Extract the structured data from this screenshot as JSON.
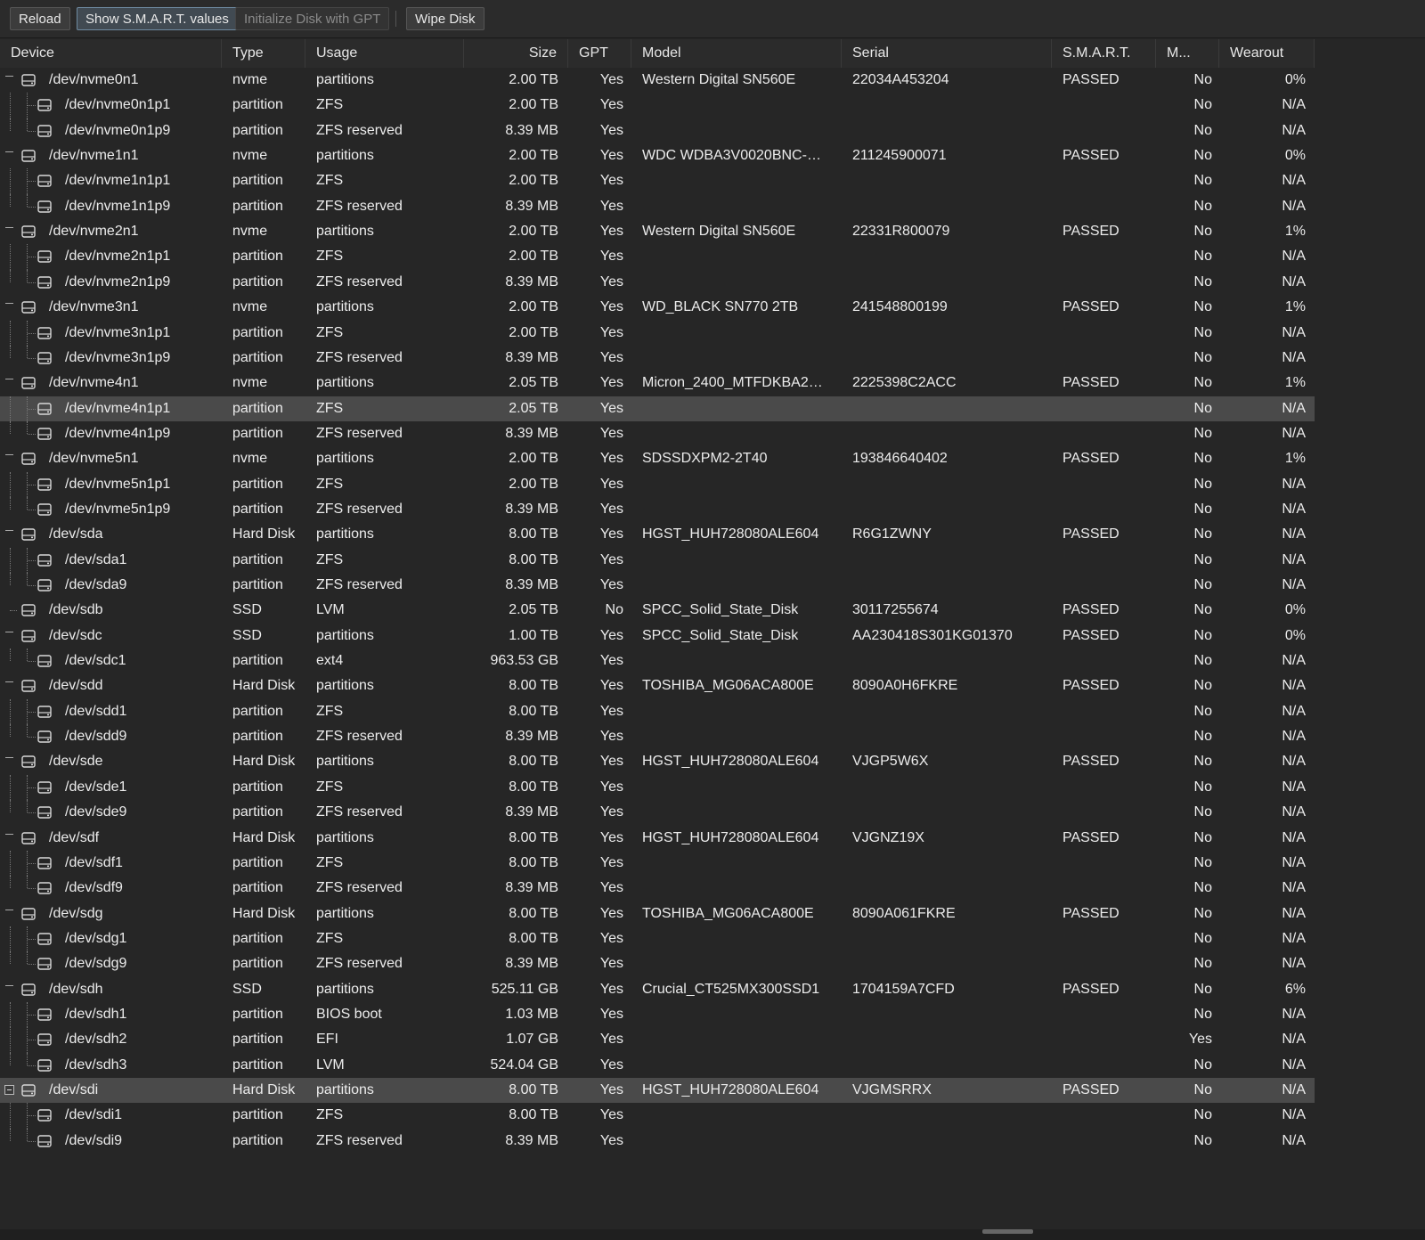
{
  "toolbar": {
    "reload": "Reload",
    "smart": "Show S.M.A.R.T. values",
    "init_gpt": "Initialize Disk with GPT",
    "wipe": "Wipe Disk"
  },
  "columns": {
    "device": "Device",
    "type": "Type",
    "usage": "Usage",
    "size": "Size",
    "gpt": "GPT",
    "model": "Model",
    "serial": "Serial",
    "smart": "S.M.A.R.T.",
    "mounted": "M...",
    "wearout": "Wearout"
  },
  "rows": [
    {
      "level": 0,
      "device": "/dev/nvme0n1",
      "type": "nvme",
      "usage": "partitions",
      "size": "2.00 TB",
      "gpt": "Yes",
      "model": "Western Digital SN560E",
      "serial": "22034A453204",
      "smart": "PASSED",
      "mounted": "No",
      "wearout": "0%"
    },
    {
      "level": 1,
      "device": "/dev/nvme0n1p1",
      "type": "partition",
      "usage": "ZFS",
      "size": "2.00 TB",
      "gpt": "Yes",
      "model": "",
      "serial": "",
      "smart": "",
      "mounted": "No",
      "wearout": "N/A"
    },
    {
      "level": 1,
      "last": true,
      "device": "/dev/nvme0n1p9",
      "type": "partition",
      "usage": "ZFS reserved",
      "size": "8.39 MB",
      "gpt": "Yes",
      "model": "",
      "serial": "",
      "smart": "",
      "mounted": "No",
      "wearout": "N/A"
    },
    {
      "level": 0,
      "device": "/dev/nvme1n1",
      "type": "nvme",
      "usage": "partitions",
      "size": "2.00 TB",
      "gpt": "Yes",
      "model": "WDC WDBA3V0020BNC-W...",
      "serial": "211245900071",
      "smart": "PASSED",
      "mounted": "No",
      "wearout": "0%"
    },
    {
      "level": 1,
      "device": "/dev/nvme1n1p1",
      "type": "partition",
      "usage": "ZFS",
      "size": "2.00 TB",
      "gpt": "Yes",
      "model": "",
      "serial": "",
      "smart": "",
      "mounted": "No",
      "wearout": "N/A"
    },
    {
      "level": 1,
      "last": true,
      "device": "/dev/nvme1n1p9",
      "type": "partition",
      "usage": "ZFS reserved",
      "size": "8.39 MB",
      "gpt": "Yes",
      "model": "",
      "serial": "",
      "smart": "",
      "mounted": "No",
      "wearout": "N/A"
    },
    {
      "level": 0,
      "device": "/dev/nvme2n1",
      "type": "nvme",
      "usage": "partitions",
      "size": "2.00 TB",
      "gpt": "Yes",
      "model": "Western Digital SN560E",
      "serial": "22331R800079",
      "smart": "PASSED",
      "mounted": "No",
      "wearout": "1%"
    },
    {
      "level": 1,
      "device": "/dev/nvme2n1p1",
      "type": "partition",
      "usage": "ZFS",
      "size": "2.00 TB",
      "gpt": "Yes",
      "model": "",
      "serial": "",
      "smart": "",
      "mounted": "No",
      "wearout": "N/A"
    },
    {
      "level": 1,
      "last": true,
      "device": "/dev/nvme2n1p9",
      "type": "partition",
      "usage": "ZFS reserved",
      "size": "8.39 MB",
      "gpt": "Yes",
      "model": "",
      "serial": "",
      "smart": "",
      "mounted": "No",
      "wearout": "N/A"
    },
    {
      "level": 0,
      "device": "/dev/nvme3n1",
      "type": "nvme",
      "usage": "partitions",
      "size": "2.00 TB",
      "gpt": "Yes",
      "model": "WD_BLACK SN770 2TB",
      "serial": "241548800199",
      "smart": "PASSED",
      "mounted": "No",
      "wearout": "1%"
    },
    {
      "level": 1,
      "device": "/dev/nvme3n1p1",
      "type": "partition",
      "usage": "ZFS",
      "size": "2.00 TB",
      "gpt": "Yes",
      "model": "",
      "serial": "",
      "smart": "",
      "mounted": "No",
      "wearout": "N/A"
    },
    {
      "level": 1,
      "last": true,
      "device": "/dev/nvme3n1p9",
      "type": "partition",
      "usage": "ZFS reserved",
      "size": "8.39 MB",
      "gpt": "Yes",
      "model": "",
      "serial": "",
      "smart": "",
      "mounted": "No",
      "wearout": "N/A"
    },
    {
      "level": 0,
      "device": "/dev/nvme4n1",
      "type": "nvme",
      "usage": "partitions",
      "size": "2.05 TB",
      "gpt": "Yes",
      "model": "Micron_2400_MTFDKBA2T0...",
      "serial": "2225398C2ACC",
      "smart": "PASSED",
      "mounted": "No",
      "wearout": "1%"
    },
    {
      "level": 1,
      "selected": true,
      "device": "/dev/nvme4n1p1",
      "type": "partition",
      "usage": "ZFS",
      "size": "2.05 TB",
      "gpt": "Yes",
      "model": "",
      "serial": "",
      "smart": "",
      "mounted": "No",
      "wearout": "N/A"
    },
    {
      "level": 1,
      "last": true,
      "device": "/dev/nvme4n1p9",
      "type": "partition",
      "usage": "ZFS reserved",
      "size": "8.39 MB",
      "gpt": "Yes",
      "model": "",
      "serial": "",
      "smart": "",
      "mounted": "No",
      "wearout": "N/A"
    },
    {
      "level": 0,
      "device": "/dev/nvme5n1",
      "type": "nvme",
      "usage": "partitions",
      "size": "2.00 TB",
      "gpt": "Yes",
      "model": "SDSSDXPM2-2T40",
      "serial": "193846640402",
      "smart": "PASSED",
      "mounted": "No",
      "wearout": "1%"
    },
    {
      "level": 1,
      "device": "/dev/nvme5n1p1",
      "type": "partition",
      "usage": "ZFS",
      "size": "2.00 TB",
      "gpt": "Yes",
      "model": "",
      "serial": "",
      "smart": "",
      "mounted": "No",
      "wearout": "N/A"
    },
    {
      "level": 1,
      "last": true,
      "device": "/dev/nvme5n1p9",
      "type": "partition",
      "usage": "ZFS reserved",
      "size": "8.39 MB",
      "gpt": "Yes",
      "model": "",
      "serial": "",
      "smart": "",
      "mounted": "No",
      "wearout": "N/A"
    },
    {
      "level": 0,
      "device": "/dev/sda",
      "type": "Hard Disk",
      "usage": "partitions",
      "size": "8.00 TB",
      "gpt": "Yes",
      "model": "HGST_HUH728080ALE604",
      "serial": "R6G1ZWNY",
      "smart": "PASSED",
      "mounted": "No",
      "wearout": "N/A"
    },
    {
      "level": 1,
      "device": "/dev/sda1",
      "type": "partition",
      "usage": "ZFS",
      "size": "8.00 TB",
      "gpt": "Yes",
      "model": "",
      "serial": "",
      "smart": "",
      "mounted": "No",
      "wearout": "N/A"
    },
    {
      "level": 1,
      "last": true,
      "device": "/dev/sda9",
      "type": "partition",
      "usage": "ZFS reserved",
      "size": "8.39 MB",
      "gpt": "Yes",
      "model": "",
      "serial": "",
      "smart": "",
      "mounted": "No",
      "wearout": "N/A"
    },
    {
      "level": 0,
      "leaf": true,
      "device": "/dev/sdb",
      "type": "SSD",
      "usage": "LVM",
      "size": "2.05 TB",
      "gpt": "No",
      "model": "SPCC_Solid_State_Disk",
      "serial": "30117255674",
      "smart": "PASSED",
      "mounted": "No",
      "wearout": "0%"
    },
    {
      "level": 0,
      "device": "/dev/sdc",
      "type": "SSD",
      "usage": "partitions",
      "size": "1.00 TB",
      "gpt": "Yes",
      "model": "SPCC_Solid_State_Disk",
      "serial": "AA230418S301KG01370",
      "smart": "PASSED",
      "mounted": "No",
      "wearout": "0%"
    },
    {
      "level": 1,
      "last": true,
      "device": "/dev/sdc1",
      "type": "partition",
      "usage": "ext4",
      "size": "963.53 GB",
      "gpt": "Yes",
      "model": "",
      "serial": "",
      "smart": "",
      "mounted": "No",
      "wearout": "N/A"
    },
    {
      "level": 0,
      "device": "/dev/sdd",
      "type": "Hard Disk",
      "usage": "partitions",
      "size": "8.00 TB",
      "gpt": "Yes",
      "model": "TOSHIBA_MG06ACA800E",
      "serial": "8090A0H6FKRE",
      "smart": "PASSED",
      "mounted": "No",
      "wearout": "N/A"
    },
    {
      "level": 1,
      "device": "/dev/sdd1",
      "type": "partition",
      "usage": "ZFS",
      "size": "8.00 TB",
      "gpt": "Yes",
      "model": "",
      "serial": "",
      "smart": "",
      "mounted": "No",
      "wearout": "N/A"
    },
    {
      "level": 1,
      "last": true,
      "device": "/dev/sdd9",
      "type": "partition",
      "usage": "ZFS reserved",
      "size": "8.39 MB",
      "gpt": "Yes",
      "model": "",
      "serial": "",
      "smart": "",
      "mounted": "No",
      "wearout": "N/A"
    },
    {
      "level": 0,
      "device": "/dev/sde",
      "type": "Hard Disk",
      "usage": "partitions",
      "size": "8.00 TB",
      "gpt": "Yes",
      "model": "HGST_HUH728080ALE604",
      "serial": "VJGP5W6X",
      "smart": "PASSED",
      "mounted": "No",
      "wearout": "N/A"
    },
    {
      "level": 1,
      "device": "/dev/sde1",
      "type": "partition",
      "usage": "ZFS",
      "size": "8.00 TB",
      "gpt": "Yes",
      "model": "",
      "serial": "",
      "smart": "",
      "mounted": "No",
      "wearout": "N/A"
    },
    {
      "level": 1,
      "last": true,
      "device": "/dev/sde9",
      "type": "partition",
      "usage": "ZFS reserved",
      "size": "8.39 MB",
      "gpt": "Yes",
      "model": "",
      "serial": "",
      "smart": "",
      "mounted": "No",
      "wearout": "N/A"
    },
    {
      "level": 0,
      "device": "/dev/sdf",
      "type": "Hard Disk",
      "usage": "partitions",
      "size": "8.00 TB",
      "gpt": "Yes",
      "model": "HGST_HUH728080ALE604",
      "serial": "VJGNZ19X",
      "smart": "PASSED",
      "mounted": "No",
      "wearout": "N/A"
    },
    {
      "level": 1,
      "device": "/dev/sdf1",
      "type": "partition",
      "usage": "ZFS",
      "size": "8.00 TB",
      "gpt": "Yes",
      "model": "",
      "serial": "",
      "smart": "",
      "mounted": "No",
      "wearout": "N/A"
    },
    {
      "level": 1,
      "last": true,
      "device": "/dev/sdf9",
      "type": "partition",
      "usage": "ZFS reserved",
      "size": "8.39 MB",
      "gpt": "Yes",
      "model": "",
      "serial": "",
      "smart": "",
      "mounted": "No",
      "wearout": "N/A"
    },
    {
      "level": 0,
      "device": "/dev/sdg",
      "type": "Hard Disk",
      "usage": "partitions",
      "size": "8.00 TB",
      "gpt": "Yes",
      "model": "TOSHIBA_MG06ACA800E",
      "serial": "8090A061FKRE",
      "smart": "PASSED",
      "mounted": "No",
      "wearout": "N/A"
    },
    {
      "level": 1,
      "device": "/dev/sdg1",
      "type": "partition",
      "usage": "ZFS",
      "size": "8.00 TB",
      "gpt": "Yes",
      "model": "",
      "serial": "",
      "smart": "",
      "mounted": "No",
      "wearout": "N/A"
    },
    {
      "level": 1,
      "last": true,
      "device": "/dev/sdg9",
      "type": "partition",
      "usage": "ZFS reserved",
      "size": "8.39 MB",
      "gpt": "Yes",
      "model": "",
      "serial": "",
      "smart": "",
      "mounted": "No",
      "wearout": "N/A"
    },
    {
      "level": 0,
      "device": "/dev/sdh",
      "type": "SSD",
      "usage": "partitions",
      "size": "525.11 GB",
      "gpt": "Yes",
      "model": "Crucial_CT525MX300SSD1",
      "serial": "1704159A7CFD",
      "smart": "PASSED",
      "mounted": "No",
      "wearout": "6%"
    },
    {
      "level": 1,
      "device": "/dev/sdh1",
      "type": "partition",
      "usage": "BIOS boot",
      "size": "1.03 MB",
      "gpt": "Yes",
      "model": "",
      "serial": "",
      "smart": "",
      "mounted": "No",
      "wearout": "N/A"
    },
    {
      "level": 1,
      "device": "/dev/sdh2",
      "type": "partition",
      "usage": "EFI",
      "size": "1.07 GB",
      "gpt": "Yes",
      "model": "",
      "serial": "",
      "smart": "",
      "mounted": "Yes",
      "wearout": "N/A"
    },
    {
      "level": 1,
      "last": true,
      "device": "/dev/sdh3",
      "type": "partition",
      "usage": "LVM",
      "size": "524.04 GB",
      "gpt": "Yes",
      "model": "",
      "serial": "",
      "smart": "",
      "mounted": "No",
      "wearout": "N/A"
    },
    {
      "level": 0,
      "selected": true,
      "focus": true,
      "device": "/dev/sdi",
      "type": "Hard Disk",
      "usage": "partitions",
      "size": "8.00 TB",
      "gpt": "Yes",
      "model": "HGST_HUH728080ALE604",
      "serial": "VJGMSRRX",
      "smart": "PASSED",
      "mounted": "No",
      "wearout": "N/A"
    },
    {
      "level": 1,
      "device": "/dev/sdi1",
      "type": "partition",
      "usage": "ZFS",
      "size": "8.00 TB",
      "gpt": "Yes",
      "model": "",
      "serial": "",
      "smart": "",
      "mounted": "No",
      "wearout": "N/A"
    },
    {
      "level": 1,
      "last": true,
      "device": "/dev/sdi9",
      "type": "partition",
      "usage": "ZFS reserved",
      "size": "8.39 MB",
      "gpt": "Yes",
      "model": "",
      "serial": "",
      "smart": "",
      "mounted": "No",
      "wearout": "N/A"
    }
  ]
}
